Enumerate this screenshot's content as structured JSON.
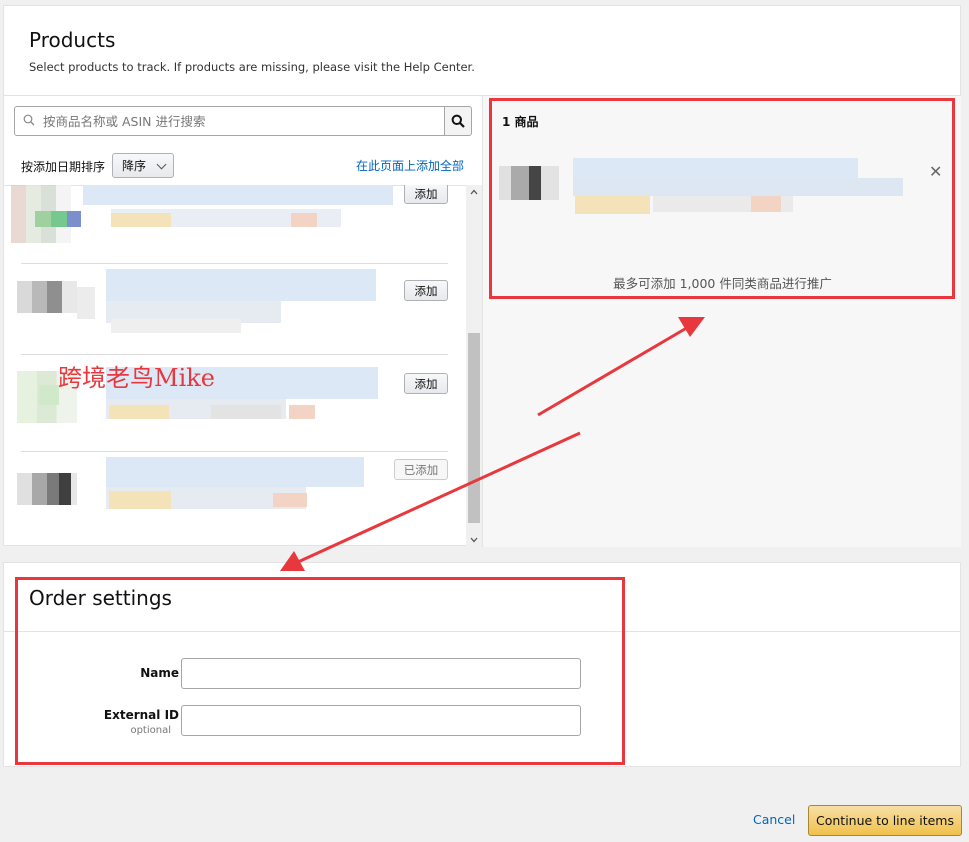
{
  "products": {
    "title": "Products",
    "subtitle": "Select products to track. If products are missing, please visit the Help Center.",
    "search": {
      "placeholder": "按商品名称或 ASIN 进行搜索"
    },
    "sort_label": "按添加日期排序",
    "sort_value": "降序",
    "add_all_link": "在此页面上添加全部",
    "items": [
      {
        "button_label": "添加"
      },
      {
        "button_label": "添加"
      },
      {
        "button_label": "添加"
      },
      {
        "button_label": "已添加"
      }
    ],
    "selected": {
      "count_label": "1 商品",
      "limit_text": "最多可添加 1,000 件同类商品进行推广"
    }
  },
  "order_settings": {
    "title": "Order settings",
    "name_label": "Name",
    "name_value": "",
    "external_id_label": "External ID",
    "external_id_hint": "optional",
    "external_id_value": ""
  },
  "footer": {
    "cancel_label": "Cancel",
    "continue_label": "Continue to line items"
  },
  "watermark": "跨境老鸟Mike",
  "colors": {
    "link": "#0066c0",
    "primary_button": "#f0c14b",
    "annotation_red": "#e8383d"
  }
}
